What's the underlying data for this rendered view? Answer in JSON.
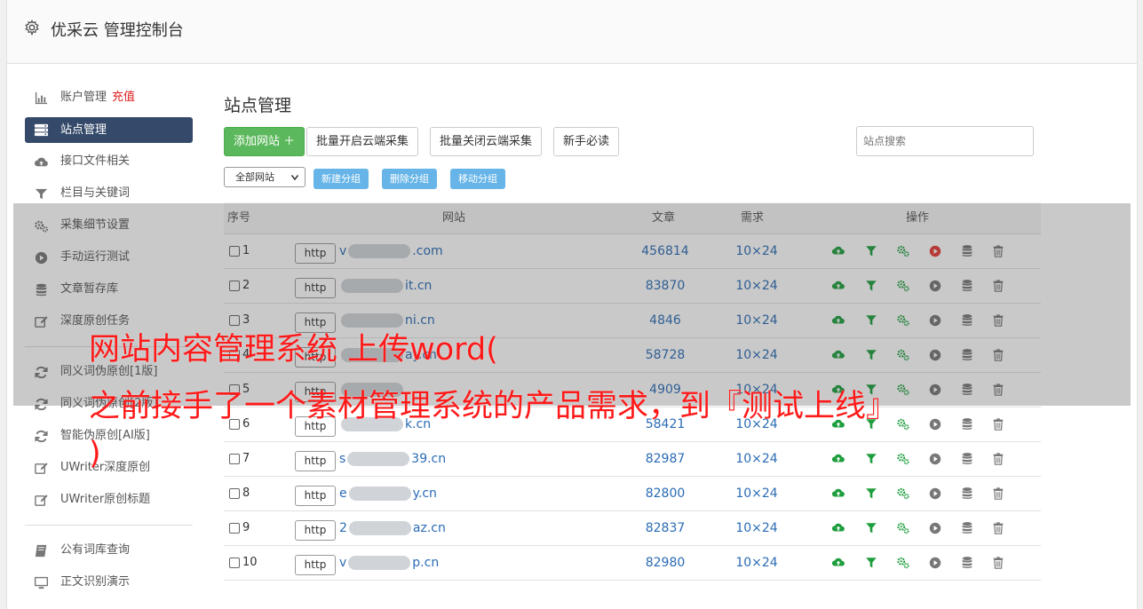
{
  "header": {
    "title": "优采云 管理控制台"
  },
  "sidebar": {
    "items": [
      {
        "label": "账户管理",
        "extra": "充值",
        "icon": "bar-chart-icon"
      },
      {
        "label": "站点管理",
        "icon": "server-icon",
        "active": true
      },
      {
        "label": "接口文件相关",
        "icon": "cloud-upload-icon"
      },
      {
        "label": "栏目与关键词",
        "icon": "filter-icon"
      },
      {
        "label": "采集细节设置",
        "icon": "gears-icon"
      },
      {
        "label": "手动运行测试",
        "icon": "play-circle-icon"
      },
      {
        "label": "文章暂存库",
        "icon": "database-icon"
      },
      {
        "label": "深度原创任务",
        "icon": "edit-icon"
      },
      {
        "label": "同义词伪原创[1版]",
        "icon": "refresh-icon"
      },
      {
        "label": "同义词伪原创[2版]",
        "icon": "refresh-icon"
      },
      {
        "label": "智能伪原创[AI版]",
        "icon": "refresh-icon"
      },
      {
        "label": "UWriter深度原创",
        "icon": "edit-icon"
      },
      {
        "label": "UWriter原创标题",
        "icon": "edit-icon"
      },
      {
        "label": "公有词库查询",
        "icon": "book-icon"
      },
      {
        "label": "正文识别演示",
        "icon": "monitor-icon"
      }
    ]
  },
  "main": {
    "title": "站点管理",
    "buttons": {
      "add_site": "添加网站 ＋",
      "batch_enable": "批量开启云端采集",
      "batch_disable": "批量关闭云端采集",
      "newbie": "新手必读"
    },
    "search_placeholder": "站点搜索",
    "group_select": "全部网站",
    "group_buttons": {
      "new": "新建分组",
      "delete": "删除分组",
      "move": "移动分组"
    },
    "table": {
      "headers": {
        "index": "序号",
        "site": "网站",
        "articles": "文章",
        "demand": "需求",
        "ops": "操作"
      },
      "rows": [
        {
          "index": "1",
          "prefix": "http",
          "site_start": "v",
          "site_end": ".com",
          "articles": "456814",
          "demand": "10×24",
          "play_active": true
        },
        {
          "index": "2",
          "prefix": "http",
          "site_start": "",
          "site_end": "it.cn",
          "articles": "83870",
          "demand": "10×24",
          "play_active": false
        },
        {
          "index": "3",
          "prefix": "http",
          "site_start": "",
          "site_end": "ni.cn",
          "articles": "4846",
          "demand": "10×24",
          "play_active": false
        },
        {
          "index": "4",
          "prefix": "http",
          "site_start": "",
          "site_end": "ay.cn",
          "articles": "58728",
          "demand": "10×24",
          "play_active": false
        },
        {
          "index": "5",
          "prefix": "http",
          "site_start": "",
          "site_end": "",
          "articles": "4909",
          "demand": "10×24",
          "play_active": false
        },
        {
          "index": "6",
          "prefix": "http",
          "site_start": "",
          "site_end": "k.cn",
          "articles": "58421",
          "demand": "10×24",
          "play_active": false
        },
        {
          "index": "7",
          "prefix": "http",
          "site_start": "s",
          "site_end": "39.cn",
          "articles": "82987",
          "demand": "10×24",
          "play_active": false
        },
        {
          "index": "8",
          "prefix": "http",
          "site_start": "e",
          "site_end": "y.cn",
          "articles": "82800",
          "demand": "10×24",
          "play_active": false
        },
        {
          "index": "9",
          "prefix": "http",
          "site_start": "2",
          "site_end": "az.cn",
          "articles": "82837",
          "demand": "10×24",
          "play_active": false
        },
        {
          "index": "10",
          "prefix": "http",
          "site_start": "v",
          "site_end": "p.cn",
          "articles": "82980",
          "demand": "10×24",
          "play_active": false
        }
      ]
    }
  },
  "overlay": {
    "line1": "网站内容管理系统 上传word(",
    "line2": "之前接手了一个素材管理系统的产品需求，到『测试上线』",
    "line3": ")"
  },
  "colors": {
    "accent": "#354a6a",
    "green": "#5cb85c",
    "link": "#2a6bb5",
    "group_button": "#67b5e8",
    "overlay_text": "#ff1a1a",
    "icon_green": "#1e9e3e",
    "icon_red": "#e53935"
  }
}
